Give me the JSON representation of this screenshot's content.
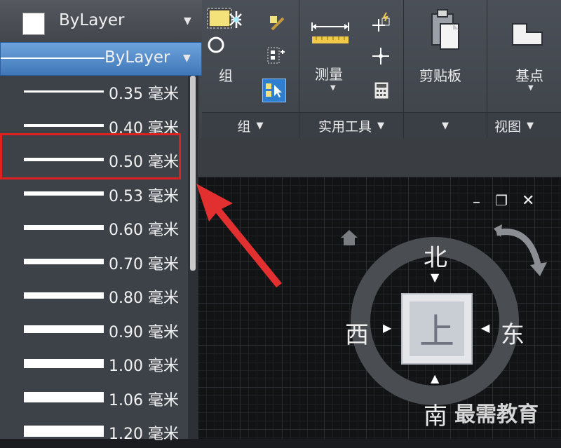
{
  "properties": {
    "color_value": "ByLayer",
    "lineweight_value": "ByLayer"
  },
  "lineweight_list": [
    {
      "label": "0.35 毫米",
      "weight": 3
    },
    {
      "label": "0.40 毫米",
      "weight": 4
    },
    {
      "label": "0.50 毫米",
      "weight": 5
    },
    {
      "label": "0.53 毫米",
      "weight": 6
    },
    {
      "label": "0.60 毫米",
      "weight": 7
    },
    {
      "label": "0.70 毫米",
      "weight": 8
    },
    {
      "label": "0.80 毫米",
      "weight": 9
    },
    {
      "label": "0.90 毫米",
      "weight": 11
    },
    {
      "label": "1.00 毫米",
      "weight": 13
    },
    {
      "label": "1.06 毫米",
      "weight": 15
    },
    {
      "label": "1.20 毫米",
      "weight": 16
    }
  ],
  "highlighted_item": "0.50 毫米",
  "ribbon": {
    "group_panel": {
      "big_label": "组",
      "footer": "组",
      "arrow": "▼"
    },
    "utilities_panel": {
      "big_label": "测量",
      "footer": "实用工具",
      "arrow": "▼"
    },
    "clipboard_panel": {
      "big_label": "剪贴板",
      "footer_arrow": "▼"
    },
    "view_panel": {
      "big_label": "基点",
      "footer": "视图",
      "arrow": "▼"
    }
  },
  "viewcube": {
    "north": "北",
    "south": "南",
    "east": "东",
    "west": "西",
    "face": "上"
  },
  "viewport_controls": {
    "minimize": "–",
    "restore": "❐",
    "close": "✕"
  },
  "watermark": "最需教育",
  "colors": {
    "accent": "#4a86c8",
    "highlight_box": "#e02020",
    "annotation_arrow": "#e23030"
  }
}
